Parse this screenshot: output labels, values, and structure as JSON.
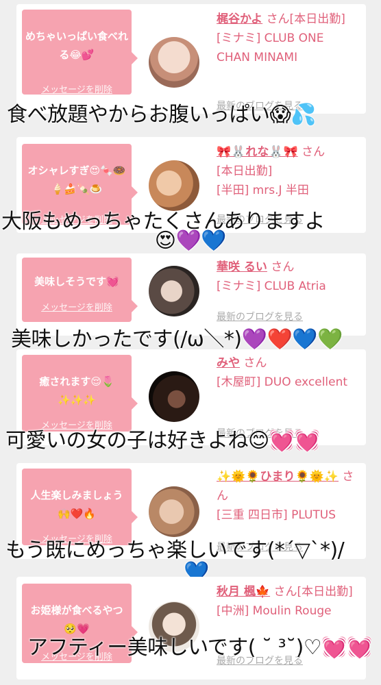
{
  "delete_label": "メッセージを削除",
  "blog_label": "最新のブログを見る",
  "san": "さん",
  "cards": [
    {
      "message": "めちゃいっぱい食べれる😂💕",
      "name": "梶谷かよ",
      "after_name": "さん[本日出勤]",
      "store": "[ミナミ] CLUB ONE CHAN MINAMI",
      "caption": "食べ放題やからお腹いっぱい😱💦",
      "avatar_color": "#e8c9b8"
    },
    {
      "message": "オシャレすぎ😍🍬🍩🍦🍰🍡🍮",
      "name": "🎀🐰れな🐰🎀",
      "after_name": "さん",
      "extra": "[本日出勤]",
      "store": "[半田] mrs.J 半田",
      "caption": "大阪もめっちゃたくさんありますよ",
      "caption_line2": "😍💜💙",
      "avatar_color": "#d8a98c"
    },
    {
      "message": "美味しそうです💓",
      "name": "華咲 るい",
      "after_name": "さん",
      "store": "[ミナミ] CLUB Atria",
      "caption": "美味しかったです(/ω＼*)💜❤️💙💚",
      "avatar_color": "#3a3330"
    },
    {
      "message": "癒されます😌🌷✨✨✨",
      "name": "みや",
      "after_name": "さん",
      "store": "[木屋町] DUO excellent",
      "caption": "可愛いの女の子は好きよね😊💓💓",
      "avatar_color": "#1c1410"
    },
    {
      "message": "人生楽しみましょう🙌❤️🔥",
      "name": "✨🌞🌻ひまり🌻🌞✨",
      "after_name": "さん",
      "store": "[三重 四日市] PLUTUS",
      "caption": "もう既にめっちゃ楽しいです(*´▽`*)/",
      "caption_line2": "💙",
      "avatar_color": "#c79a78"
    },
    {
      "message": "お姫様が食べるやつ🥺💗",
      "name": "秋月 楓🍁",
      "after_name": "さん[本日出勤]",
      "store": "[中洲] Moulin Rouge",
      "caption": "アフティー美味しいです( ˘ ³˘)♡💓💓",
      "avatar_color": "#e9e4df"
    }
  ]
}
